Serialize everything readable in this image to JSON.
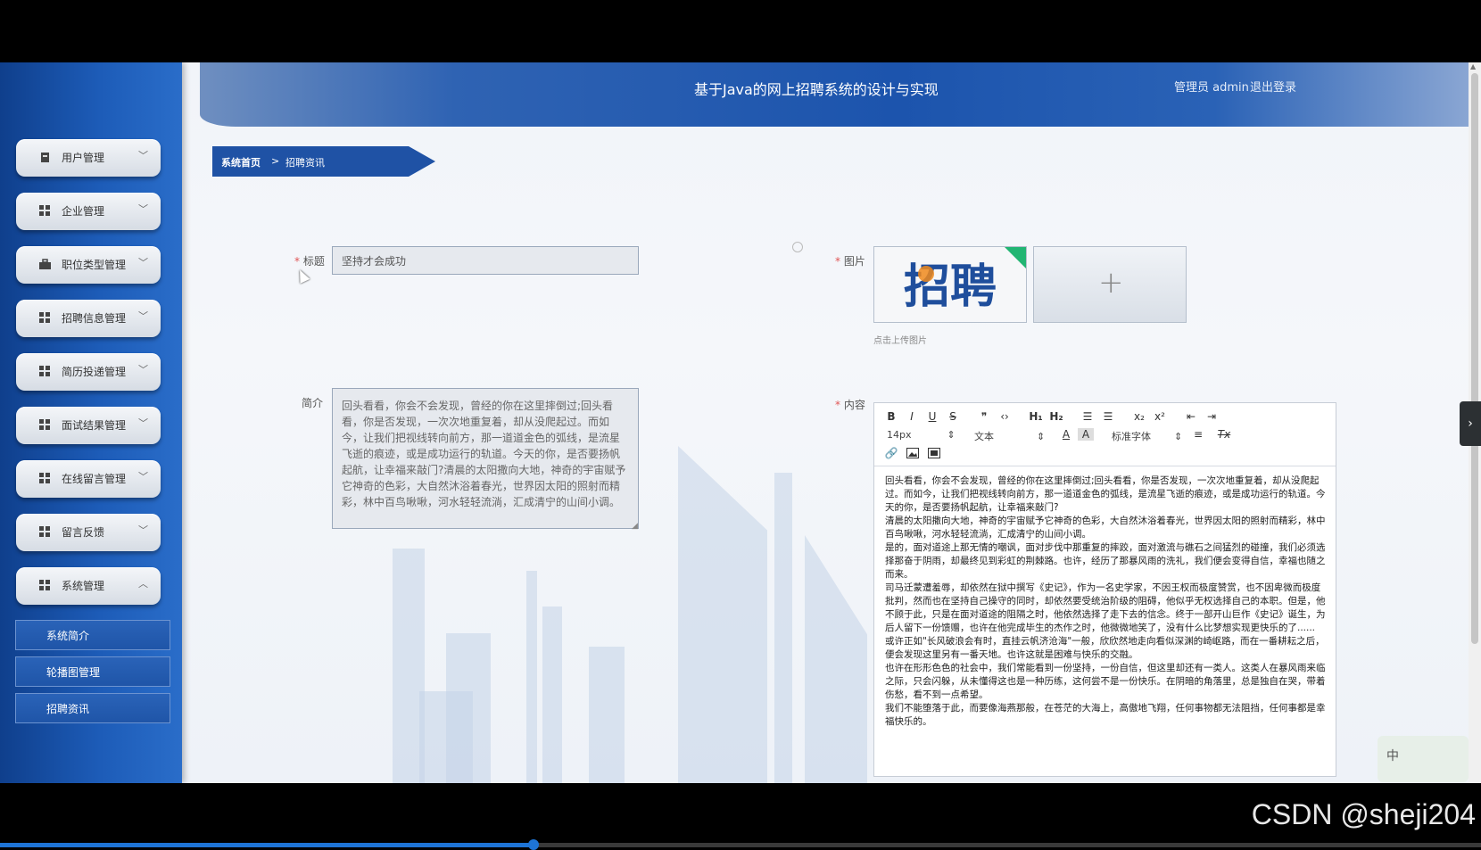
{
  "header": {
    "title": "基于Java的网上招聘系统的设计与实现",
    "user_label": "管理员 admin",
    "logout": "退出登录"
  },
  "sidebar": {
    "items": [
      {
        "label": "用户管理",
        "icon": "user-icon",
        "expanded": false
      },
      {
        "label": "企业管理",
        "icon": "grid-icon",
        "expanded": false
      },
      {
        "label": "职位类型管理",
        "icon": "briefcase-icon",
        "expanded": false
      },
      {
        "label": "招聘信息管理",
        "icon": "grid-icon",
        "expanded": false
      },
      {
        "label": "简历投递管理",
        "icon": "grid-icon",
        "expanded": false
      },
      {
        "label": "面试结果管理",
        "icon": "grid-icon",
        "expanded": false
      },
      {
        "label": "在线留言管理",
        "icon": "grid-icon",
        "expanded": false
      },
      {
        "label": "留言反馈",
        "icon": "grid-icon",
        "expanded": false
      },
      {
        "label": "系统管理",
        "icon": "grid-icon",
        "expanded": true
      }
    ],
    "sub_items": [
      {
        "label": "系统简介"
      },
      {
        "label": "轮播图管理"
      },
      {
        "label": "招聘资讯"
      }
    ]
  },
  "breadcrumb": {
    "home": "系统首页",
    "separator": ">",
    "current": "招聘资讯"
  },
  "form": {
    "title_label": "标题",
    "title_value": "坚持才会成功",
    "intro_label": "简介",
    "intro_value": "回头看看，你会不会发现，曾经的你在这里摔倒过;回头看看，你是否发现，一次次地重复着，却从没爬起过。而如今，让我们把视线转向前方，那一道道金色的弧线，是流星飞逝的痕迹，或是成功运行的轨道。今天的你，是否要扬帆起航，让幸福来敲门?清晨的太阳撒向大地，神奇的宇宙赋予它神奇的色彩，大自然沐浴着春光，世界因太阳的照射而精彩，林中百鸟啾啾，河水轻轻流淌，汇成清宁的山间小调。",
    "image_label": "图片",
    "upload_hint": "点击上传图片",
    "upload_thumb_text": "招聘",
    "upload_plus": "+",
    "content_label": "内容",
    "required_mark": "*"
  },
  "editor": {
    "toolbar": {
      "bold": "B",
      "italic": "I",
      "underline": "U",
      "strike": "S",
      "quote": "❞",
      "code": "‹›",
      "h1": "H₁",
      "h2": "H₂",
      "ol": "☰",
      "ul": "☰",
      "sub": "x₂",
      "sup": "x²",
      "outdent": "⇤",
      "indent": "⇥",
      "size": "14px",
      "type": "文本",
      "font_color": "A",
      "bg_color": "A",
      "font": "标准字体",
      "align": "≡",
      "clear": "Tx"
    },
    "paragraphs": [
      "回头看看，你会不会发现，曾经的你在这里摔倒过;回头看看，你是否发现，一次次地重复着，却从没爬起过。而如今，让我们把视线转向前方，那一道道金色的弧线，是流星飞逝的痕迹，或是成功运行的轨道。今天的你，是否要扬帆起航，让幸福来敲门?",
      "清晨的太阳撒向大地，神奇的宇宙赋予它神奇的色彩，大自然沐浴着春光，世界因太阳的照射而精彩，林中百鸟啾啾，河水轻轻流淌，汇成清宁的山间小调。",
      "是的，面对道途上那无情的嘲讽，面对步伐中那重复的摔跤，面对激流与礁石之间猛烈的碰撞，我们必须选择那奋于阴雨，却最终见到彩虹的荆棘路。也许，经历了那暴风雨的洗礼，我们便会变得自信，幸福也随之而来。",
      "司马迁蒙遭羞辱，却依然在狱中撰写《史记》，作为一名史学家，不因王权而极度赞赏，也不因卑微而极度批判，然而也在坚持自己操守的同时，却依然要受统治阶级的阻碍，他似乎无权选择自己的本职。但是，他不顾于此，只是在面对道途的阻隔之时，他依然选择了走下去的信念。终于一部开山巨作《史记》诞生，为后人留下一份馈赠，也许在他完成毕生的杰作之时，他微微地笑了，没有什么比梦想实现更快乐的了......",
      "或许正如\"长风破浪会有时，直挂云帆济沧海\"一般，欣欣然地走向看似深渊的崎岖路，而在一番耕耘之后，便会发现这里另有一番天地。也许这就是困难与快乐的交融。",
      "也许在形形色色的社会中，我们常能看到一份坚持，一份自信，但这里却还有一类人。这类人在暴风雨来临之际，只会闪躲，从未懂得这也是一种历练，这何尝不是一份快乐。在阴暗的角落里，总是独自在哭，带着伤愁，看不到一点希望。",
      "我们不能堕落于此，而要像海燕那般，在苍茫的大海上，高傲地飞翔，任何事物都无法阻挡，任何事都是幸福快乐的。"
    ]
  },
  "overlay": {
    "watermark": "CSDN @sheji204",
    "ime": "中",
    "video_progress": 0.36
  },
  "colors": {
    "sidebar": "#1d5cb8",
    "header": "#1c54ad",
    "accent_required": "#e05555"
  }
}
